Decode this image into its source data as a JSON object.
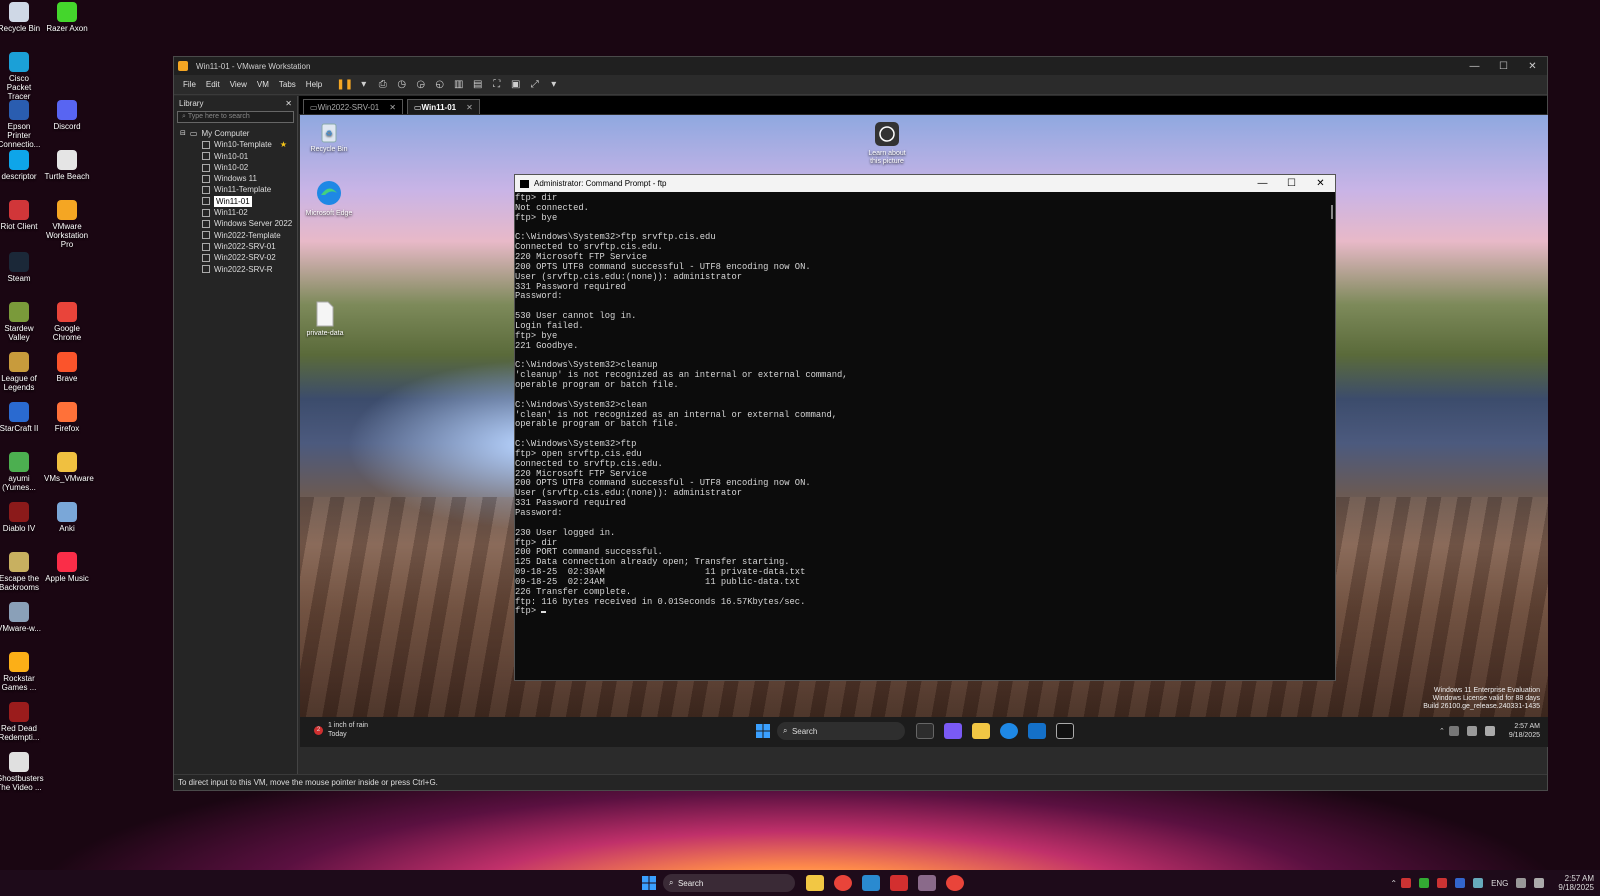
{
  "host_desktop": {
    "icons": [
      {
        "label": "Recycle Bin",
        "color": "#cfd8e6"
      },
      {
        "label": "Razer Axon",
        "color": "#44d62c"
      },
      {
        "label": "Cisco Packet Tracer",
        "color": "#1ba0d7"
      },
      {
        "label": "Epson Printer Connectio...",
        "color": "#2a5db0"
      },
      {
        "label": "Discord",
        "color": "#5865f2"
      },
      {
        "label": "descriptor",
        "color": "#0ea5e9"
      },
      {
        "label": "Turtle Beach",
        "color": "#e5e5e5"
      },
      {
        "label": "Riot Client",
        "color": "#d13639"
      },
      {
        "label": "VMware Workstation Pro",
        "color": "#f5a623"
      },
      {
        "label": "Steam",
        "color": "#1b2838"
      },
      {
        "label": "Stardew Valley",
        "color": "#7a9a3a"
      },
      {
        "label": "Google Chrome",
        "color": "#e9443a"
      },
      {
        "label": "League of Legends",
        "color": "#c89b3c"
      },
      {
        "label": "Brave",
        "color": "#fb542b"
      },
      {
        "label": "StarCraft II",
        "color": "#2a6ad0"
      },
      {
        "label": "Firefox",
        "color": "#ff7139"
      },
      {
        "label": "ayumi (Yumes...",
        "color": "#4caf50"
      },
      {
        "label": "VMs_VMware",
        "color": "#f0c040"
      },
      {
        "label": "Diablo IV",
        "color": "#8b1a1a"
      },
      {
        "label": "Anki",
        "color": "#7aa7d8"
      },
      {
        "label": "Escape the Backrooms",
        "color": "#c8b060"
      },
      {
        "label": "Apple Music",
        "color": "#fa2d48"
      },
      {
        "label": "VMware-w...",
        "color": "#8aa0b8"
      },
      {
        "label": "Rockstar Games ...",
        "color": "#fcaf17"
      },
      {
        "label": "Red Dead Redempti...",
        "color": "#9b1c1c"
      },
      {
        "label": "Ghostbusters The Video ...",
        "color": "#e0e0e0"
      }
    ]
  },
  "vmware": {
    "title": "Win11-01 - VMware Workstation",
    "window_controls": {
      "minimize": "—",
      "maximize": "☐",
      "close": "✕"
    },
    "menu": [
      "File",
      "Edit",
      "View",
      "VM",
      "Tabs",
      "Help"
    ],
    "toolbar": {
      "pause": "❚❚",
      "dropdown": "▾"
    },
    "library": {
      "title": "Library",
      "close": "✕",
      "search_placeholder": "Type here to search",
      "root": "My Computer",
      "items": [
        "Win10-Template",
        "Win10-01",
        "Win10-02",
        "Windows 11",
        "Win11-Template",
        "Win11-01",
        "Win11-02",
        "Windows Server 2022",
        "Win2022-Template",
        "Win2022-SRV-01",
        "Win2022-SRV-02",
        "Win2022-SRV-R"
      ],
      "selected": "Win11-01",
      "starred": "Win10-Template"
    },
    "tabs": [
      {
        "label": "Win2022-SRV-01",
        "active": false
      },
      {
        "label": "Win11-01",
        "active": true
      }
    ],
    "status": "To direct input to this VM, move the mouse pointer inside or press Ctrl+G."
  },
  "guest": {
    "icons": {
      "recycle": "Recycle Bin",
      "learn": "Learn about this picture",
      "edge": "Microsoft Edge",
      "file": "private-data"
    },
    "watermark": [
      "Windows 11 Enterprise Evaluation",
      "Windows License valid for 88 days",
      "Build 26100.ge_release.240331-1435"
    ],
    "weather": {
      "badge": "2",
      "line1": "1 inch of rain",
      "line2": "Today"
    },
    "search": "Search",
    "time": "2:57 AM",
    "date": "9/18/2025"
  },
  "cmd": {
    "title": "Administrator: Command Prompt - ftp",
    "lines": [
      "ftp> dir",
      "Not connected.",
      "ftp> bye",
      "",
      "C:\\Windows\\System32>ftp srvftp.cis.edu",
      "Connected to srvftp.cis.edu.",
      "220 Microsoft FTP Service",
      "200 OPTS UTF8 command successful - UTF8 encoding now ON.",
      "User (srvftp.cis.edu:(none)): administrator",
      "331 Password required",
      "Password:",
      "",
      "530 User cannot log in.",
      "Login failed.",
      "ftp> bye",
      "221 Goodbye.",
      "",
      "C:\\Windows\\System32>cleanup",
      "'cleanup' is not recognized as an internal or external command,",
      "operable program or batch file.",
      "",
      "C:\\Windows\\System32>clean",
      "'clean' is not recognized as an internal or external command,",
      "operable program or batch file.",
      "",
      "C:\\Windows\\System32>ftp",
      "ftp> open srvftp.cis.edu",
      "Connected to srvftp.cis.edu.",
      "220 Microsoft FTP Service",
      "200 OPTS UTF8 command successful - UTF8 encoding now ON.",
      "User (srvftp.cis.edu:(none)): administrator",
      "331 Password required",
      "Password:",
      "",
      "230 User logged in.",
      "ftp> dir",
      "200 PORT command successful.",
      "125 Data connection already open; Transfer starting.",
      "09-18-25  02:39AM                   11 private-data.txt",
      "09-18-25  02:24AM                   11 public-data.txt",
      "226 Transfer complete.",
      "ftp: 116 bytes received in 0.01Seconds 16.57Kbytes/sec."
    ],
    "prompt": "ftp> "
  },
  "host_taskbar": {
    "search": "Search",
    "lang": "ENG",
    "time": "2:57 AM",
    "date": "9/18/2025"
  }
}
